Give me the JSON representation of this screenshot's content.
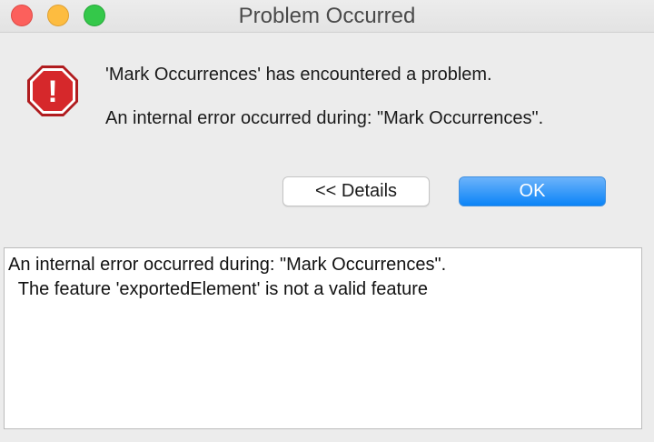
{
  "window": {
    "title": "Problem Occurred"
  },
  "icon": {
    "name": "error-stop-icon",
    "glyph": "!",
    "color": "#d6282b"
  },
  "message": {
    "line1": "'Mark Occurrences' has encountered a problem.",
    "line2": "An internal error occurred during: \"Mark Occurrences\"."
  },
  "buttons": {
    "details_label": "<< Details",
    "ok_label": "OK"
  },
  "details": {
    "line1": "An internal error occurred during: \"Mark Occurrences\".",
    "line2": "  The feature 'exportedElement' is not a valid feature"
  },
  "colors": {
    "accent": "#0b84f7",
    "close": "#fc605c",
    "minimize": "#fdbc40",
    "maximize": "#34c84a"
  }
}
